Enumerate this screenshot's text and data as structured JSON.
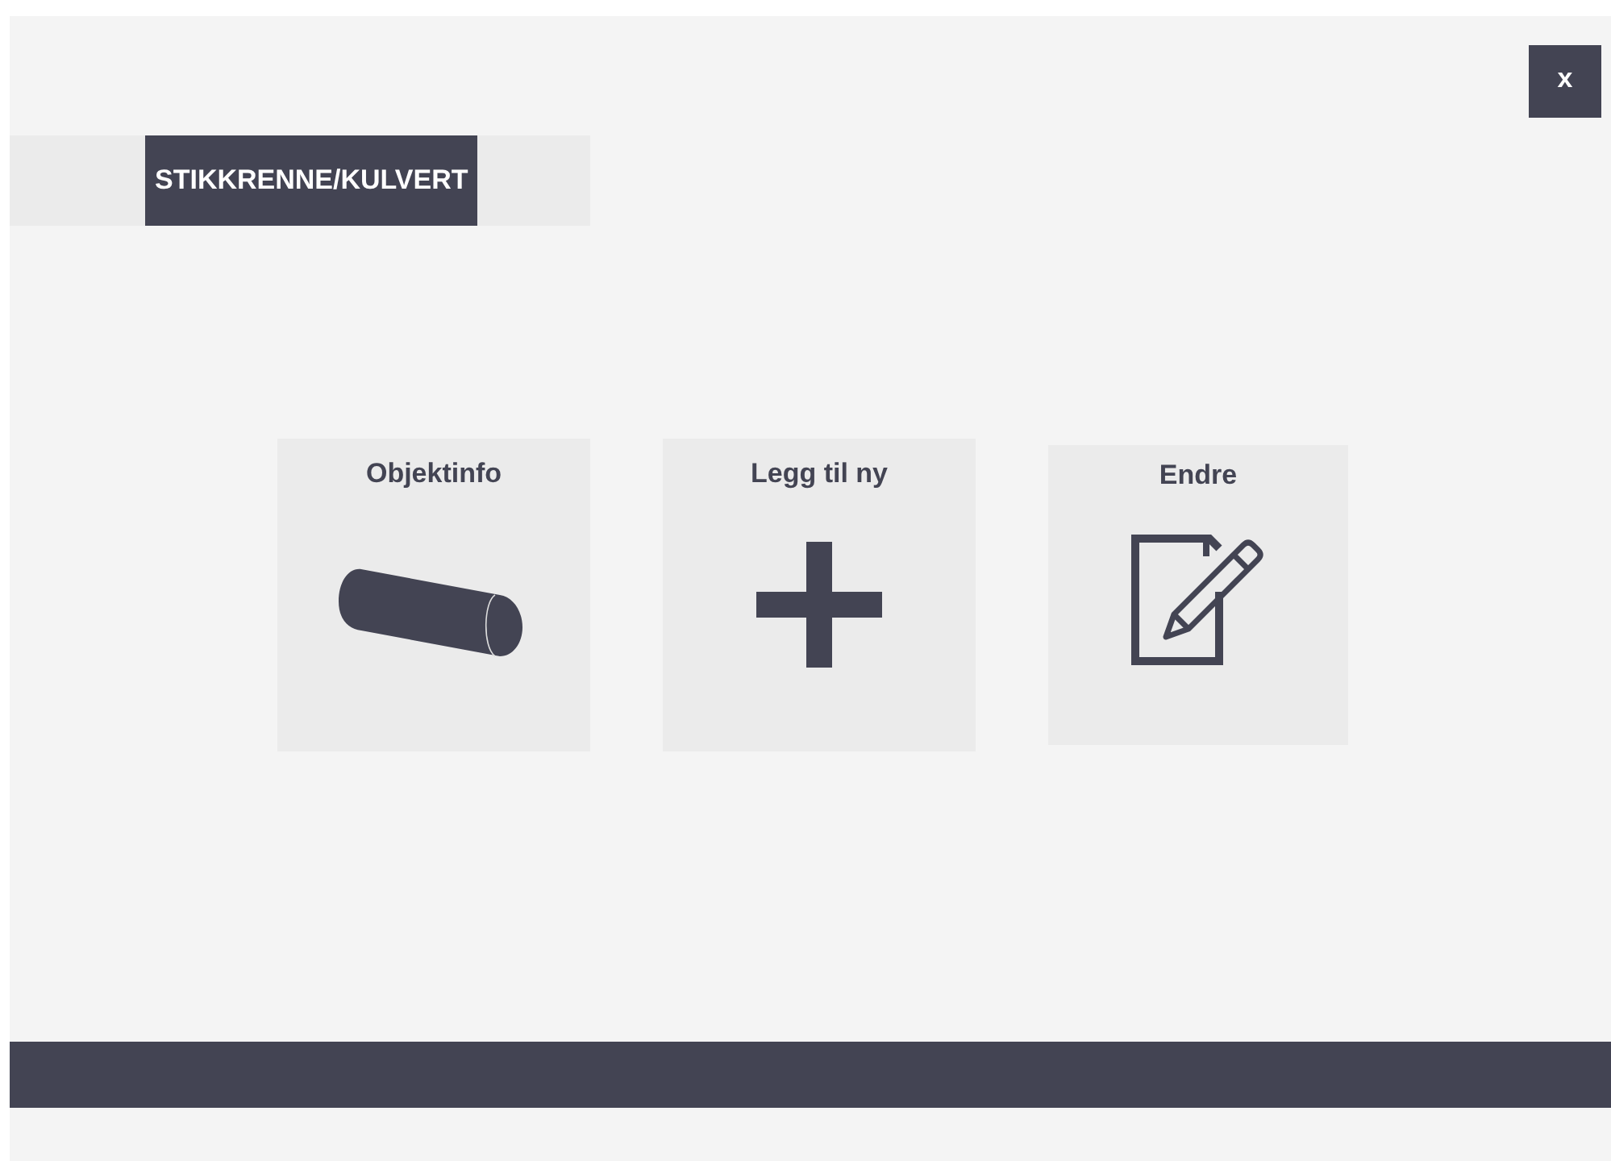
{
  "close_button": {
    "label": "x"
  },
  "tabs": [
    {
      "label": "STIKKRENNE/KULVERT",
      "selected": true
    }
  ],
  "tiles": [
    {
      "label": "Objektinfo",
      "kind": "pipe"
    },
    {
      "label": "Legg til ny",
      "kind": "add"
    },
    {
      "label": "Endre",
      "kind": "edit"
    }
  ]
}
